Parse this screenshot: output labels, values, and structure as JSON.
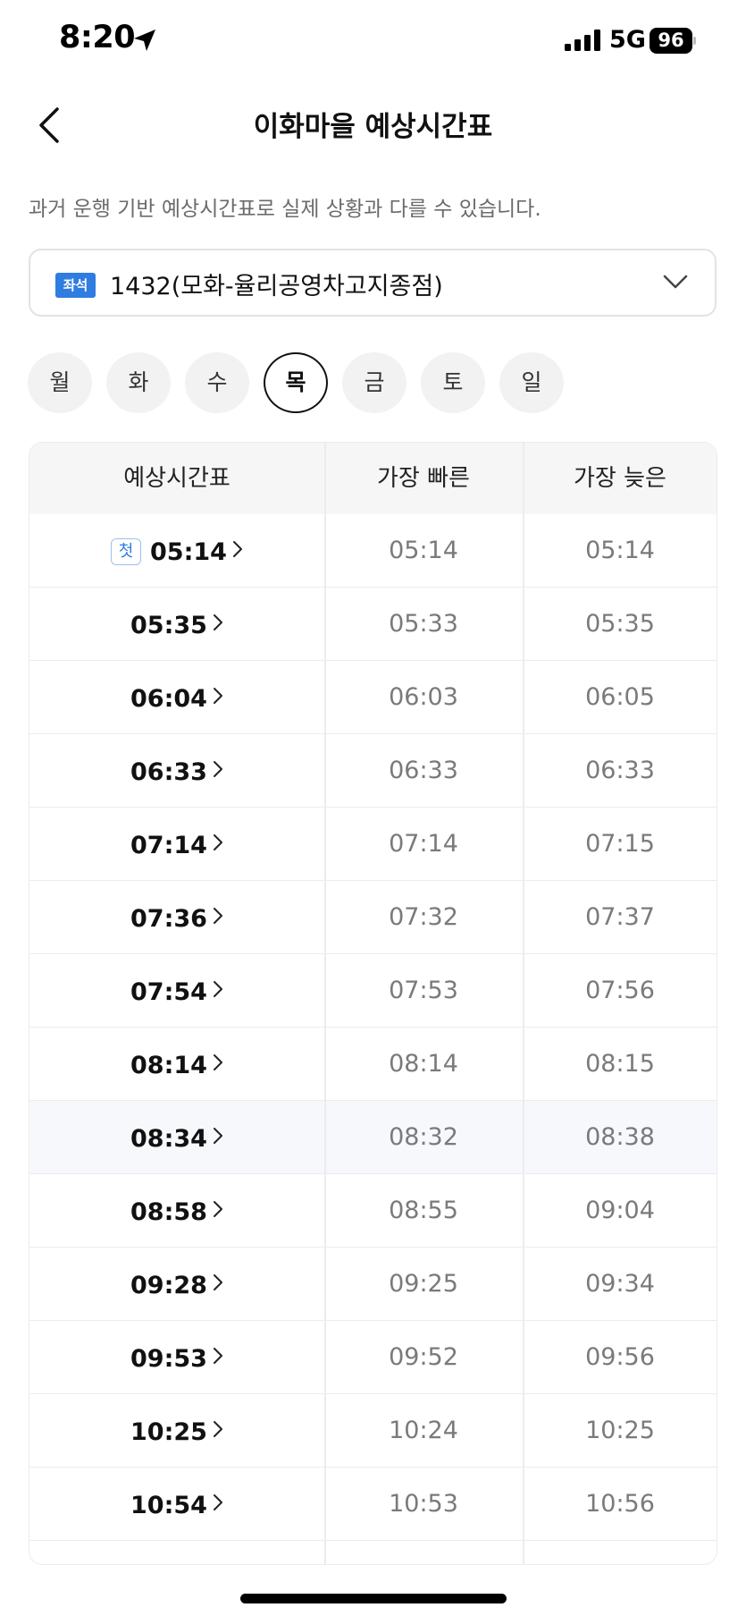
{
  "status_bar": {
    "time": "8:20",
    "network": "5G",
    "battery": "96",
    "icons": [
      "location-arrow-icon",
      "signal-bars-icon",
      "battery-icon"
    ]
  },
  "header": {
    "title": "이화마을 예상시간표",
    "back_icon": "chevron-left-icon"
  },
  "notice": "과거 운행 기반 예상시간표로 실제 상황과 다를 수 있습니다.",
  "route": {
    "badge": "좌석",
    "name": "1432(모화-율리공영차고지종점)",
    "badge_color": "#2f7de1",
    "dropdown_icon": "chevron-down-icon"
  },
  "days": {
    "items": [
      "월",
      "화",
      "수",
      "목",
      "금",
      "토",
      "일"
    ],
    "selected": "목"
  },
  "table": {
    "headers": [
      "예상시간표",
      "가장 빠른",
      "가장 늦은"
    ],
    "first_badge": "첫",
    "rows": [
      {
        "scheduled": "05:14",
        "earliest": "05:14",
        "latest": "05:14"
      },
      {
        "scheduled": "05:35",
        "earliest": "05:33",
        "latest": "05:35"
      },
      {
        "scheduled": "06:04",
        "earliest": "06:03",
        "latest": "06:05"
      },
      {
        "scheduled": "06:33",
        "earliest": "06:33",
        "latest": "06:33"
      },
      {
        "scheduled": "07:14",
        "earliest": "07:14",
        "latest": "07:15"
      },
      {
        "scheduled": "07:36",
        "earliest": "07:32",
        "latest": "07:37"
      },
      {
        "scheduled": "07:54",
        "earliest": "07:53",
        "latest": "07:56"
      },
      {
        "scheduled": "08:14",
        "earliest": "08:14",
        "latest": "08:15"
      },
      {
        "scheduled": "08:34",
        "earliest": "08:32",
        "latest": "08:38"
      },
      {
        "scheduled": "08:58",
        "earliest": "08:55",
        "latest": "09:04"
      },
      {
        "scheduled": "09:28",
        "earliest": "09:25",
        "latest": "09:34"
      },
      {
        "scheduled": "09:53",
        "earliest": "09:52",
        "latest": "09:56"
      },
      {
        "scheduled": "10:25",
        "earliest": "10:24",
        "latest": "10:25"
      },
      {
        "scheduled": "10:54",
        "earliest": "10:53",
        "latest": "10:56"
      }
    ],
    "highlighted_row": "08:34"
  }
}
